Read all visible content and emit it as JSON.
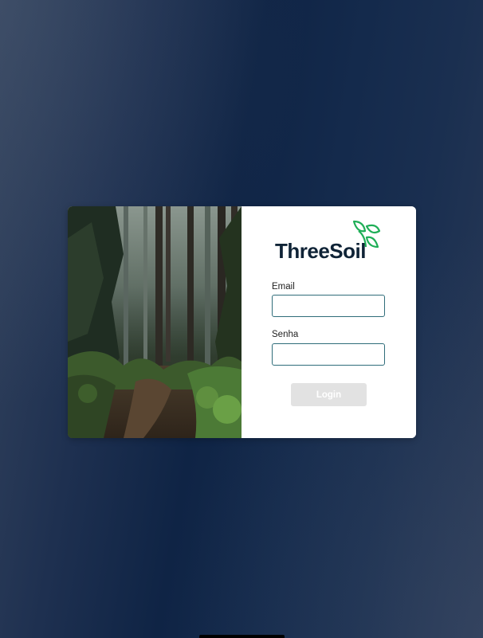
{
  "logo": {
    "text": "ThreeSoil",
    "icon": "leaf-icon",
    "brand_color": "#0f2336",
    "leaf_color": "#1fae57"
  },
  "form": {
    "email_label": "Email",
    "email_value": "",
    "password_label": "Senha",
    "password_value": "",
    "login_label": "Login"
  },
  "colors": {
    "background": "#0f2445",
    "input_border": "#2f6d7a",
    "button_disabled": "#e2e2e2"
  }
}
